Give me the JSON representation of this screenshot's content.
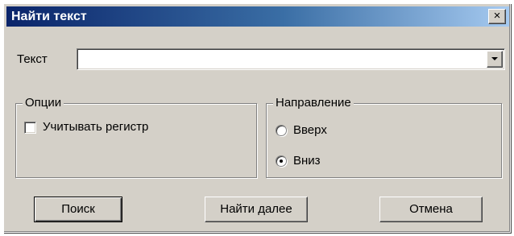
{
  "dialog": {
    "title": "Найти текст",
    "close_icon": "close-icon",
    "close_glyph": "×"
  },
  "search": {
    "label": "Текст",
    "value": "",
    "placeholder": ""
  },
  "options": {
    "legend": "Опции",
    "match_case_label": "Учитывать регистр",
    "match_case_checked": false
  },
  "direction": {
    "legend": "Направление",
    "up_label": "Вверх",
    "down_label": "Вниз",
    "selected": "down"
  },
  "buttons": {
    "search_label": "Поиск",
    "find_next_label": "Найти далее",
    "cancel_label": "Отмена"
  },
  "colors": {
    "face": "#d4d0c8",
    "title_start": "#0a246a",
    "title_end": "#a6caf0"
  }
}
